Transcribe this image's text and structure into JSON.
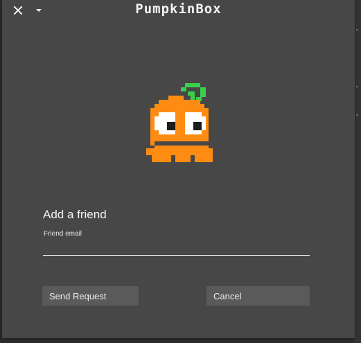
{
  "window": {
    "title": "PumpkinBox"
  },
  "titlebar": {
    "close_icon": "close-icon",
    "menu_icon": "caret-down-icon"
  },
  "mascot": {
    "icon": "pixel-pumpkin-icon",
    "colors": {
      "body": "#ff8c12",
      "stem": "#3ad14a",
      "eye_white": "#ffffff",
      "pupil": "#1c1c1c"
    }
  },
  "form": {
    "heading": "Add a friend",
    "email_label": "Friend email",
    "email_value": "",
    "email_placeholder": ""
  },
  "actions": {
    "send_label": "Send Request",
    "cancel_label": "Cancel"
  },
  "theme": {
    "window_bg": "#474747",
    "button_bg": "#5a5a5a",
    "text": "#f2f2f2"
  }
}
